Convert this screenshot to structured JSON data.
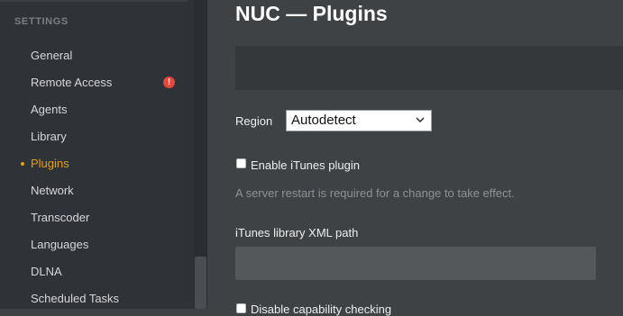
{
  "sidebar": {
    "heading": "SETTINGS",
    "items": [
      {
        "label": "General"
      },
      {
        "label": "Remote Access"
      },
      {
        "label": "Agents"
      },
      {
        "label": "Library"
      },
      {
        "label": "Plugins"
      },
      {
        "label": "Network"
      },
      {
        "label": "Transcoder"
      },
      {
        "label": "Languages"
      },
      {
        "label": "DLNA"
      },
      {
        "label": "Scheduled Tasks"
      }
    ],
    "active_item": "Plugins",
    "warning_glyph": "!",
    "warning_icon": "alert-icon"
  },
  "main": {
    "title": "NUC — Plugins",
    "region": {
      "label": "Region",
      "selected": "Autodetect"
    },
    "itunes_checkbox": {
      "label": "Enable iTunes plugin",
      "checked": false
    },
    "restart_note": "A server restart is required for a change to take effect.",
    "xml_path": {
      "label": "iTunes library XML path",
      "value": ""
    },
    "capability_checkbox": {
      "label": "Disable capability checking",
      "checked": false
    }
  },
  "colors": {
    "accent": "#e5a00d",
    "warning": "#e5473b",
    "sidebar_bg": "#2f3236",
    "content_bg": "#3f4245"
  }
}
